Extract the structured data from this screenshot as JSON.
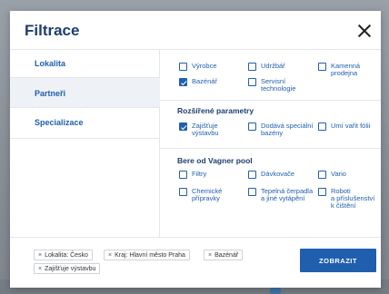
{
  "modal": {
    "title": "Filtrace",
    "submit_label": "ZOBRAZIT"
  },
  "sidebar": {
    "items": [
      {
        "label": "Lokalita"
      },
      {
        "label": "Partneři"
      },
      {
        "label": "Specializace"
      }
    ]
  },
  "partners": [
    {
      "label": "Výrobce",
      "checked": false
    },
    {
      "label": "Udržbář",
      "checked": false
    },
    {
      "label": "Kamenná\nprodejna",
      "checked": false
    },
    {
      "label": "Bazénář",
      "checked": true
    },
    {
      "label": "Servisní\ntechnologie",
      "checked": false
    }
  ],
  "extended": {
    "title": "Rozšířené parametry",
    "options": [
      {
        "label": "Zajišťuje\nvýstavbu",
        "checked": true
      },
      {
        "label": "Dodává speciální\nbazény",
        "checked": false
      },
      {
        "label": "Umí vařit fólii",
        "checked": false
      }
    ]
  },
  "vagner": {
    "title": "Bere od Vagner pool",
    "options": [
      {
        "label": "Filtry",
        "checked": false
      },
      {
        "label": "Dávkovače",
        "checked": false
      },
      {
        "label": "Vario",
        "checked": false
      },
      {
        "label": "Chemické\npřípravky",
        "checked": false
      },
      {
        "label": "Tepelná čerpadla\na jiné vytápění",
        "checked": false
      },
      {
        "label": "Roboti\na příslušenství\nk čištění",
        "checked": false
      }
    ]
  },
  "chips": [
    {
      "label": "Lokalita: Česko"
    },
    {
      "label": "Kraj: Hlavní město Praha"
    },
    {
      "label": "Bazénář"
    },
    {
      "label": "Zajišťuje výstavbu"
    }
  ],
  "icons": {
    "close": "close-icon",
    "chip_remove": "remove-icon",
    "check": "check-icon"
  },
  "colors": {
    "accent": "#1f5fae",
    "title": "#1e3e6e"
  }
}
